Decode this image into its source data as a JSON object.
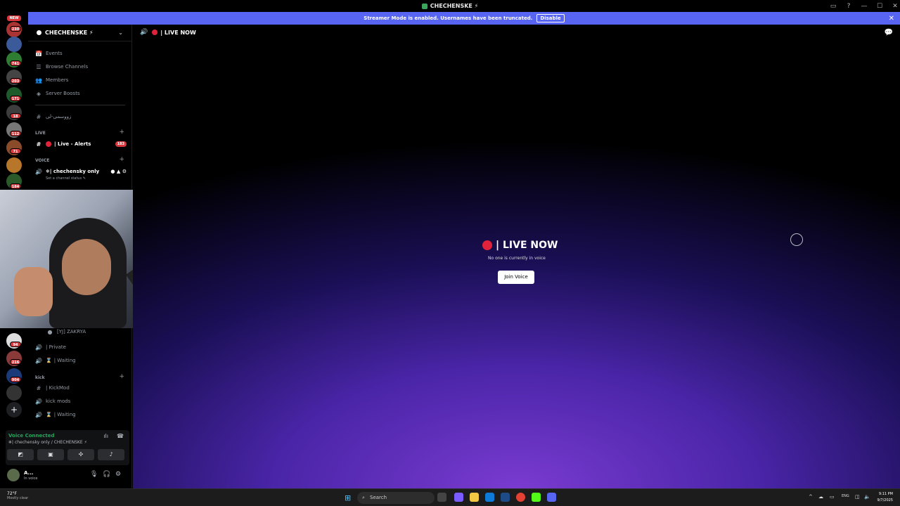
{
  "window": {
    "title": "CHECHENSKE ⚡",
    "controls": [
      "▭",
      "?",
      "—",
      "☐",
      "✕"
    ]
  },
  "banner": {
    "text": "Streamer Mode is enabled. Usernames have been truncated.",
    "button": "Disable",
    "close": "✕"
  },
  "guilds": {
    "new_badge": "NEW",
    "badges": [
      "230",
      "741",
      "203",
      "171",
      "18",
      "112",
      "71",
      "184",
      "94",
      "216",
      "904"
    ]
  },
  "sidebar": {
    "server_name": "CHECHENSKE ⚡",
    "nav": [
      {
        "label": "Events",
        "icon": "📅"
      },
      {
        "label": "Browse Channels",
        "icon": "☰"
      },
      {
        "label": "Members",
        "icon": "👥"
      },
      {
        "label": "Server Boosts",
        "icon": "◈"
      }
    ],
    "rules_channel": "زووسمی-لی",
    "categories": {
      "live": "LIVE",
      "voice": "VOICE",
      "kick": "kick"
    },
    "live_channel": {
      "label": "| Live - Alerts",
      "badge": "183"
    },
    "voice_channel": {
      "label": "❄| chechensky only",
      "status": "Set a channel status ✎"
    },
    "member_name": "[YJ] ZAKRYA",
    "voice_channels": [
      "| Private",
      "| Waiting"
    ],
    "kick_channels": [
      {
        "label": "| KickMod",
        "icon": "#"
      },
      {
        "label": "kick mods",
        "icon": "🔊"
      },
      {
        "label": "| Waiting",
        "icon": "🔊"
      }
    ]
  },
  "voice_panel": {
    "title": "Voice Connected",
    "subtitle": "❄| chechensky only / CHECHENSKE ⚡"
  },
  "user": {
    "name": "A...",
    "status": "In voice"
  },
  "main": {
    "header_title": "| LIVE NOW",
    "center_title": "| LIVE NOW",
    "center_sub": "No one is currently in voice",
    "join_button": "Join Voice"
  },
  "taskbar": {
    "temp": "72°F",
    "condition": "Mostly clear",
    "search_placeholder": "Search",
    "lang": "ENG",
    "time": "9:11 PM",
    "date": "9/7/2025"
  }
}
